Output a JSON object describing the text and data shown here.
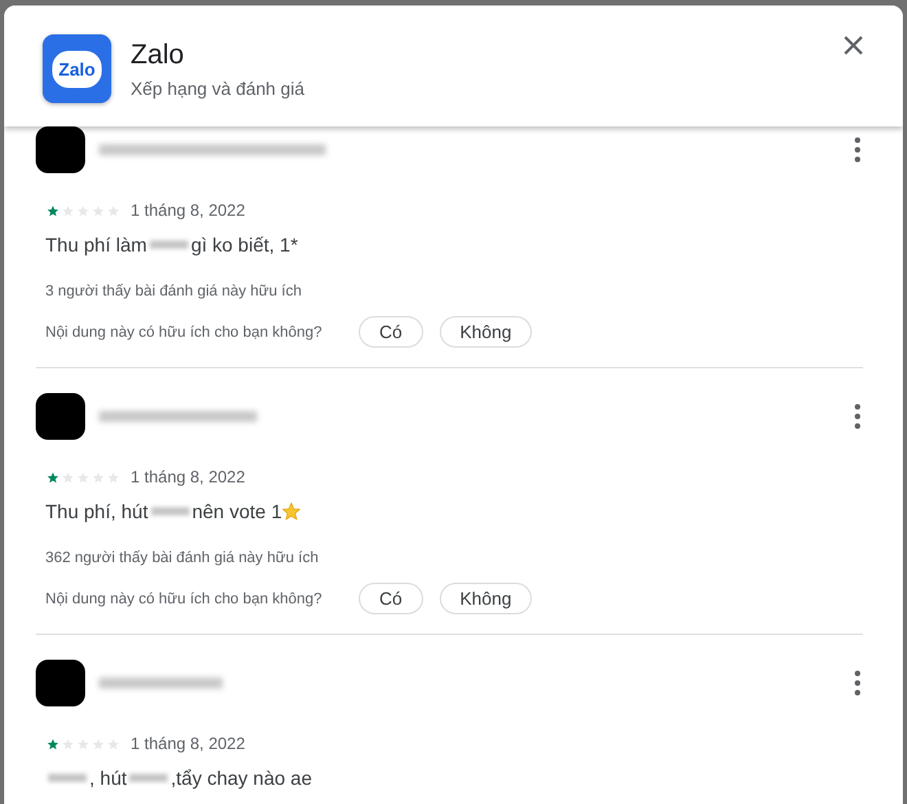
{
  "header": {
    "app_icon_text": "Zalo",
    "title": "Zalo",
    "subtitle": "Xếp hạng và đánh giá"
  },
  "reviews": [
    {
      "stars": 1,
      "date": "1 tháng 8, 2022",
      "text_parts": [
        {
          "kind": "text",
          "text": "Thu phí làm"
        },
        {
          "kind": "redacted"
        },
        {
          "kind": "text",
          "text": "gì ko biết, 1*"
        }
      ],
      "helpful_count": "3 người thấy bài đánh giá này hữu ích",
      "question": "Nội dung này có hữu ích cho bạn không?",
      "buttons": [
        "Có",
        "Không"
      ]
    },
    {
      "stars": 1,
      "date": "1 tháng 8, 2022",
      "text_parts": [
        {
          "kind": "text",
          "text": "Thu phí, hút"
        },
        {
          "kind": "redacted"
        },
        {
          "kind": "text",
          "text": "nên vote 1"
        },
        {
          "kind": "star_emoji"
        }
      ],
      "helpful_count": "362 người thấy bài đánh giá này hữu ích",
      "question": "Nội dung này có hữu ích cho bạn không?",
      "buttons": [
        "Có",
        "Không"
      ]
    },
    {
      "stars": 1,
      "date": "1 tháng 8, 2022",
      "text_parts": [
        {
          "kind": "redacted"
        },
        {
          "kind": "text",
          "text": ", hút"
        },
        {
          "kind": "redacted"
        },
        {
          "kind": "text",
          "text": ",tẩy chay nào ae"
        }
      ]
    }
  ]
}
